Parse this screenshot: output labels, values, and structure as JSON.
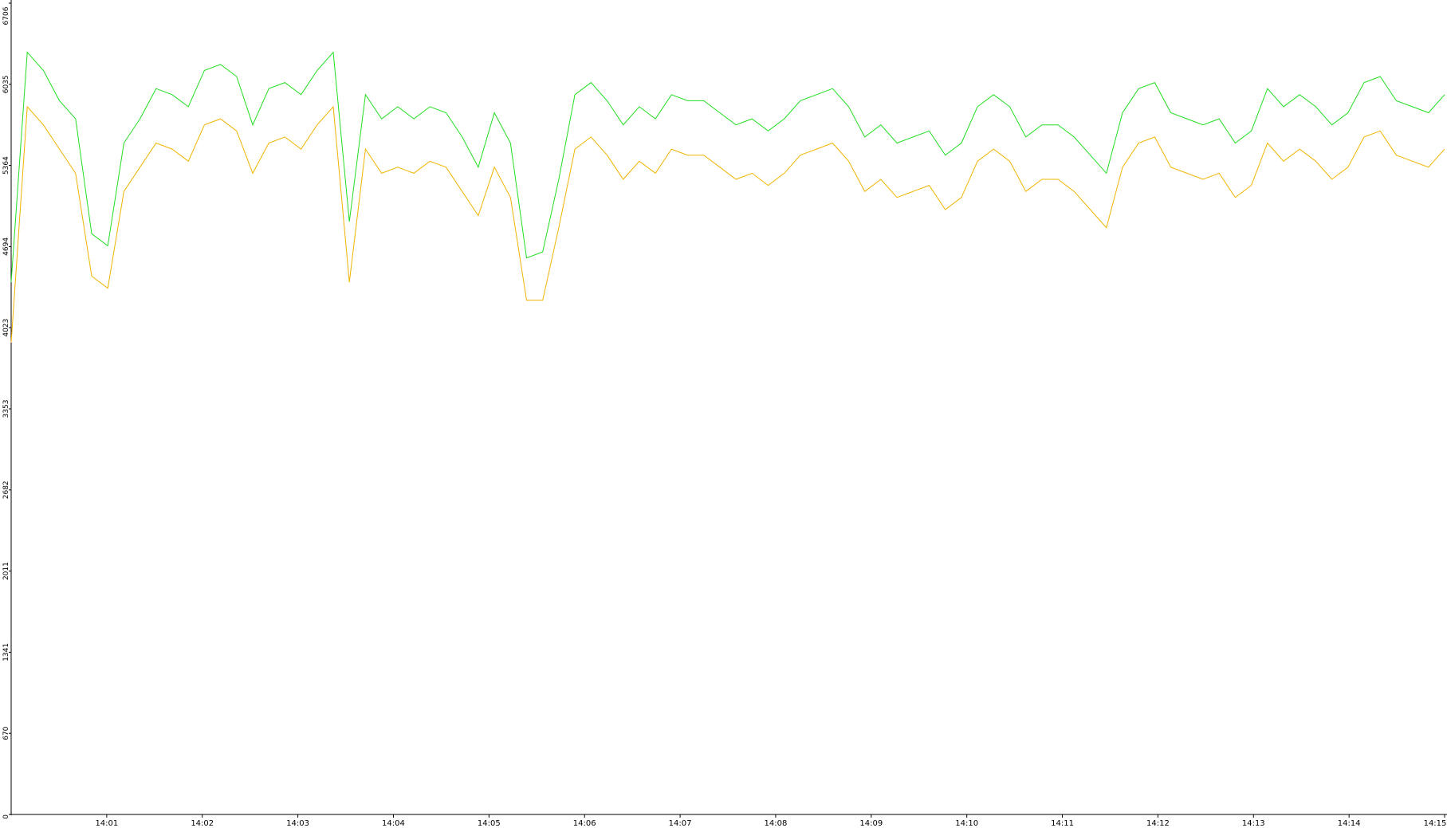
{
  "chart_data": {
    "type": "line",
    "title": "",
    "xlabel": "",
    "ylabel": "",
    "ylim": [
      0,
      6706
    ],
    "y_ticks": [
      "0",
      "670",
      "1341",
      "2011",
      "2682",
      "3353",
      "4023",
      "4694",
      "5364",
      "6035",
      "6706"
    ],
    "x_range": [
      "14:00:00",
      "14:15:00"
    ],
    "x_ticks": [
      "14:01",
      "14:02",
      "14:03",
      "14:04",
      "14:05",
      "14:06",
      "14:07",
      "14:08",
      "14:09",
      "14:10",
      "14:11",
      "14:12",
      "14:13",
      "14:14",
      "14:15"
    ],
    "grid": false,
    "legend": "none",
    "series": [
      {
        "color": "#22dd22",
        "values": [
          4400,
          6300,
          6150,
          5900,
          5750,
          4800,
          4700,
          5550,
          5750,
          6000,
          5950,
          5850,
          6150,
          6200,
          6100,
          5700,
          6000,
          6050,
          5950,
          6150,
          6300,
          4900,
          5950,
          5750,
          5850,
          5750,
          5850,
          5800,
          5600,
          5350,
          5800,
          5550,
          4600,
          4650,
          5250,
          5950,
          6050,
          5900,
          5700,
          5850,
          5750,
          5950,
          5900,
          5900,
          5800,
          5700,
          5750,
          5650,
          5750,
          5900,
          5950,
          6000,
          5850,
          5600,
          5700,
          5550,
          5600,
          5650,
          5450,
          5550,
          5850,
          5950,
          5850,
          5600,
          5700,
          5700,
          5600,
          5450,
          5300,
          5800,
          6000,
          6050,
          5800,
          5750,
          5700,
          5750,
          5550,
          5650,
          6000,
          5850,
          5950,
          5850,
          5700,
          5800,
          6050,
          6100,
          5900,
          5850,
          5800,
          5950
        ]
      },
      {
        "color": "#f0b400",
        "values": [
          3900,
          5850,
          5700,
          5500,
          5300,
          4450,
          4350,
          5150,
          5350,
          5550,
          5500,
          5400,
          5700,
          5750,
          5650,
          5300,
          5550,
          5600,
          5500,
          5700,
          5850,
          4400,
          5500,
          5300,
          5350,
          5300,
          5400,
          5350,
          5150,
          4950,
          5350,
          5100,
          4250,
          4250,
          4850,
          5500,
          5600,
          5450,
          5250,
          5400,
          5300,
          5500,
          5450,
          5450,
          5350,
          5250,
          5300,
          5200,
          5300,
          5450,
          5500,
          5550,
          5400,
          5150,
          5250,
          5100,
          5150,
          5200,
          5000,
          5100,
          5400,
          5500,
          5400,
          5150,
          5250,
          5250,
          5150,
          5000,
          4850,
          5350,
          5550,
          5600,
          5350,
          5300,
          5250,
          5300,
          5100,
          5200,
          5550,
          5400,
          5500,
          5400,
          5250,
          5350,
          5600,
          5650,
          5450,
          5400,
          5350,
          5500
        ]
      }
    ]
  }
}
